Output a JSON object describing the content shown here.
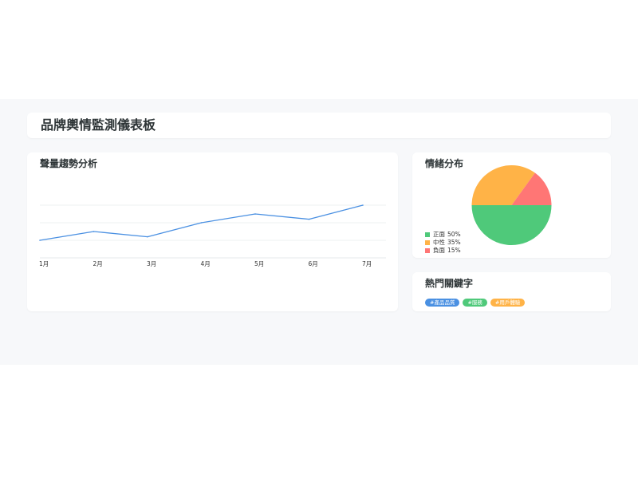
{
  "header": {
    "title": "品牌輿情監測儀表板"
  },
  "trend": {
    "title": "聲量趨勢分析",
    "line_color": "#4a90e2"
  },
  "sentiment": {
    "title": "情緒分布",
    "items": [
      {
        "label": "正面",
        "pct": "50%",
        "color": "#4fc97a"
      },
      {
        "label": "中性",
        "pct": "35%",
        "color": "#ffb347"
      },
      {
        "label": "負面",
        "pct": "15%",
        "color": "#ff7675"
      }
    ]
  },
  "keywords": {
    "title": "熱門關鍵字",
    "tags": [
      {
        "text": "#產品品質",
        "color": "#4a90e2"
      },
      {
        "text": "#服務",
        "color": "#4fc97a"
      },
      {
        "text": "#用戶體驗",
        "color": "#ffb347"
      }
    ]
  },
  "chart_data": [
    {
      "type": "line",
      "title": "聲量趨勢分析",
      "categories": [
        "1月",
        "2月",
        "3月",
        "4月",
        "5月",
        "6月",
        "7月"
      ],
      "values": [
        1.0,
        1.5,
        1.2,
        2.0,
        2.5,
        2.2,
        3.0
      ],
      "ylim": [
        0,
        3
      ],
      "grid": true,
      "color": "#4a90e2"
    },
    {
      "type": "pie",
      "title": "情緒分布",
      "categories": [
        "正面",
        "中性",
        "負面"
      ],
      "values": [
        50,
        35,
        15
      ],
      "colors": [
        "#4fc97a",
        "#ffb347",
        "#ff7675"
      ],
      "legend": "left"
    }
  ]
}
